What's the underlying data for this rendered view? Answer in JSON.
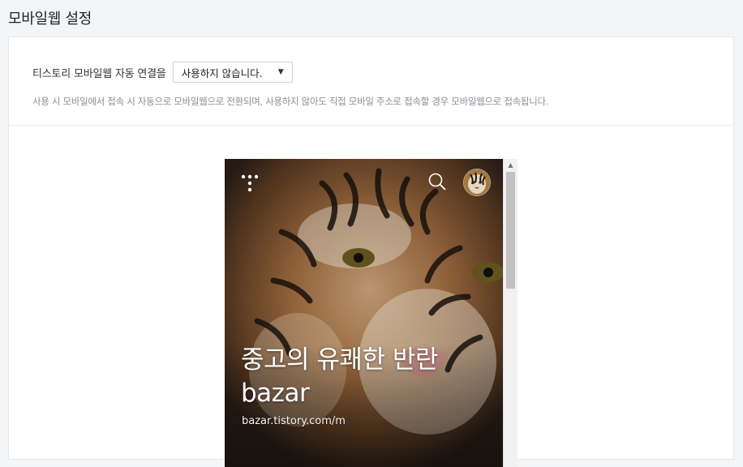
{
  "page": {
    "title": "모바일웹 설정"
  },
  "setting": {
    "label": "티스토리 모바일웹 자동 연결을",
    "select_value": "사용하지 않습니다.",
    "help": "사용 시 모바일에서 접속 시 자동으로 모바일웹으로 전환되며, 사용하지 않아도 직접 모바일 주소로 접속할 경우 모바일웹으로 접속됩니다."
  },
  "preview": {
    "blog_title_line1": "중고의 유쾌한 반란",
    "blog_title_line2": "bazar",
    "blog_url": "bazar.tistory.com/m",
    "icons": {
      "menu": "dots-menu-icon",
      "search": "search-icon",
      "avatar": "tiger-avatar"
    }
  },
  "colors": {
    "background": "#f4f5f7",
    "panel": "#ffffff",
    "help_text": "#8b8d93"
  }
}
